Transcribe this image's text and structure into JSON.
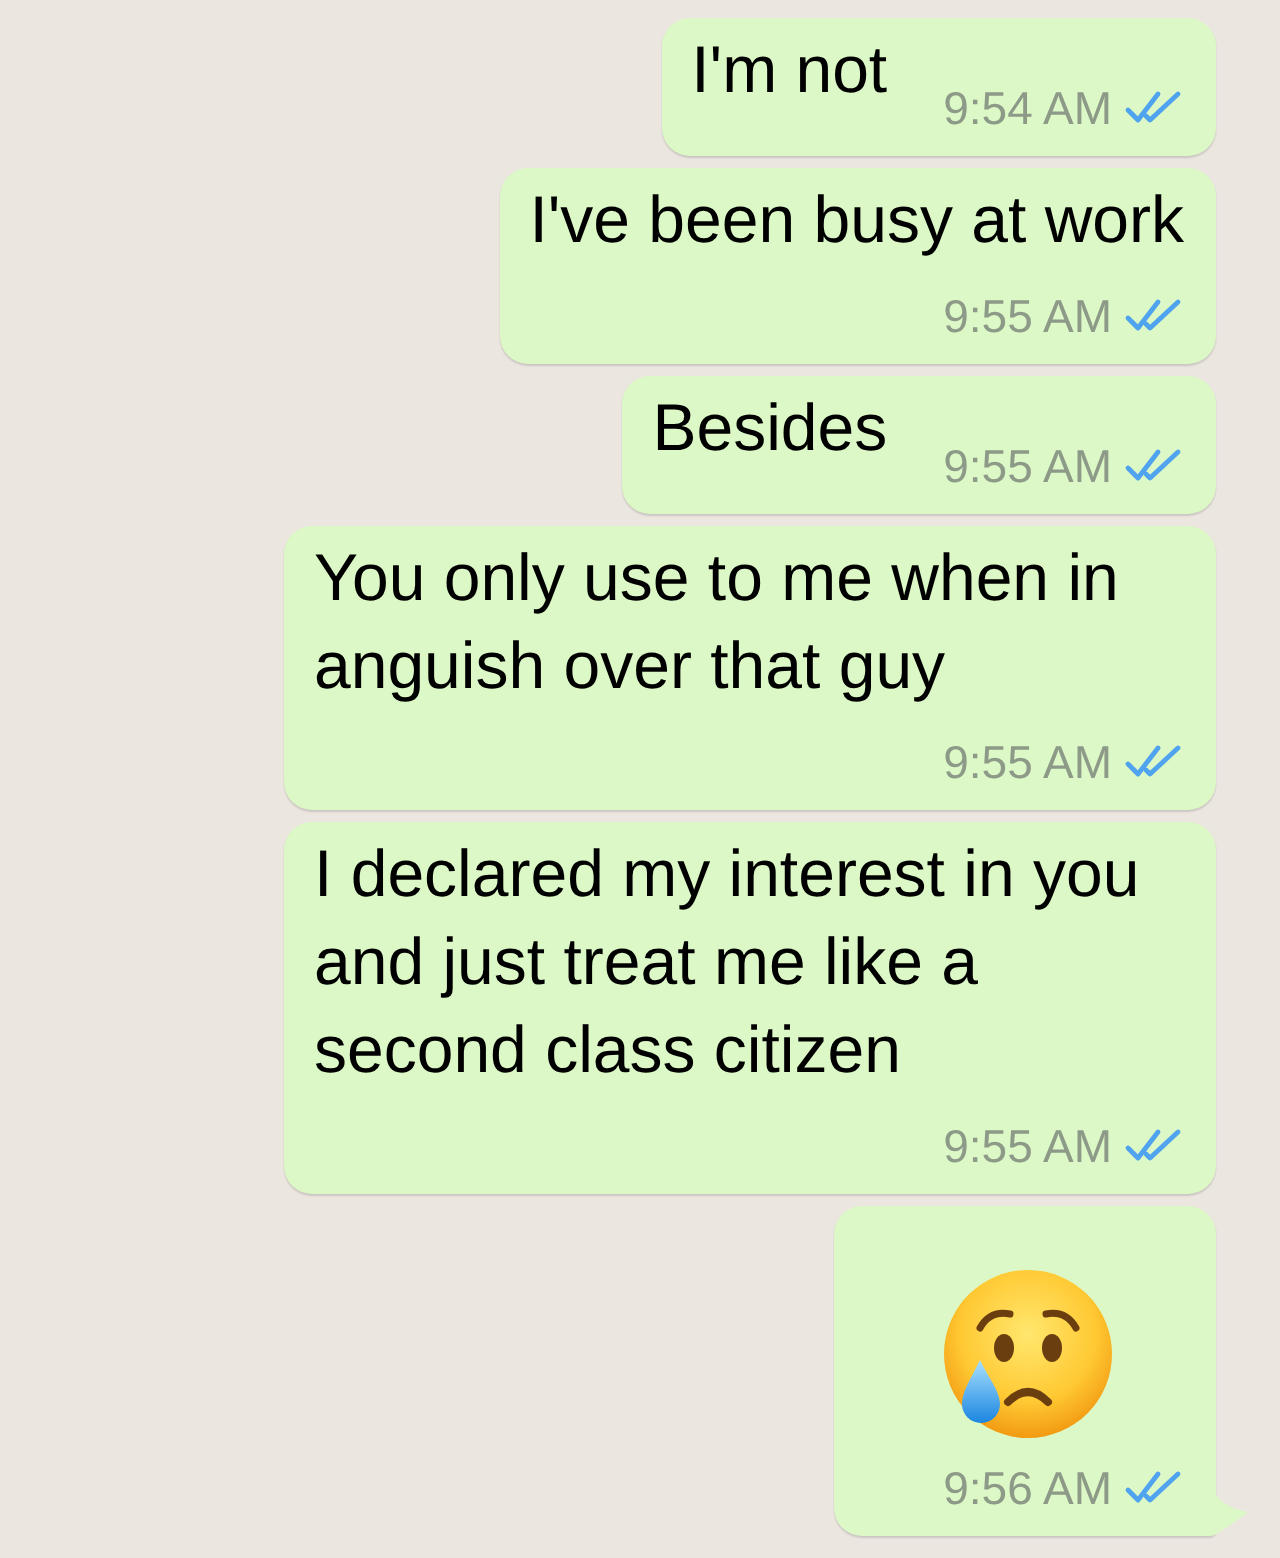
{
  "messages": [
    {
      "kind": "text",
      "text": "I'm not",
      "time": "9:54 AM",
      "read": true,
      "tail": false
    },
    {
      "kind": "text",
      "text": "I've been busy at work",
      "time": "9:55 AM",
      "read": true,
      "tail": false
    },
    {
      "kind": "text",
      "text": "Besides",
      "time": "9:55 AM",
      "read": true,
      "tail": false
    },
    {
      "kind": "text",
      "text": "You only use to me when in anguish over that guy",
      "time": "9:55 AM",
      "read": true,
      "tail": false
    },
    {
      "kind": "text",
      "text": "I declared my interest in you and just treat me like a second class citizen",
      "time": "9:55 AM",
      "read": true,
      "tail": false
    },
    {
      "kind": "emoji",
      "time": "9:56 AM",
      "read": true,
      "tail": true
    }
  ]
}
